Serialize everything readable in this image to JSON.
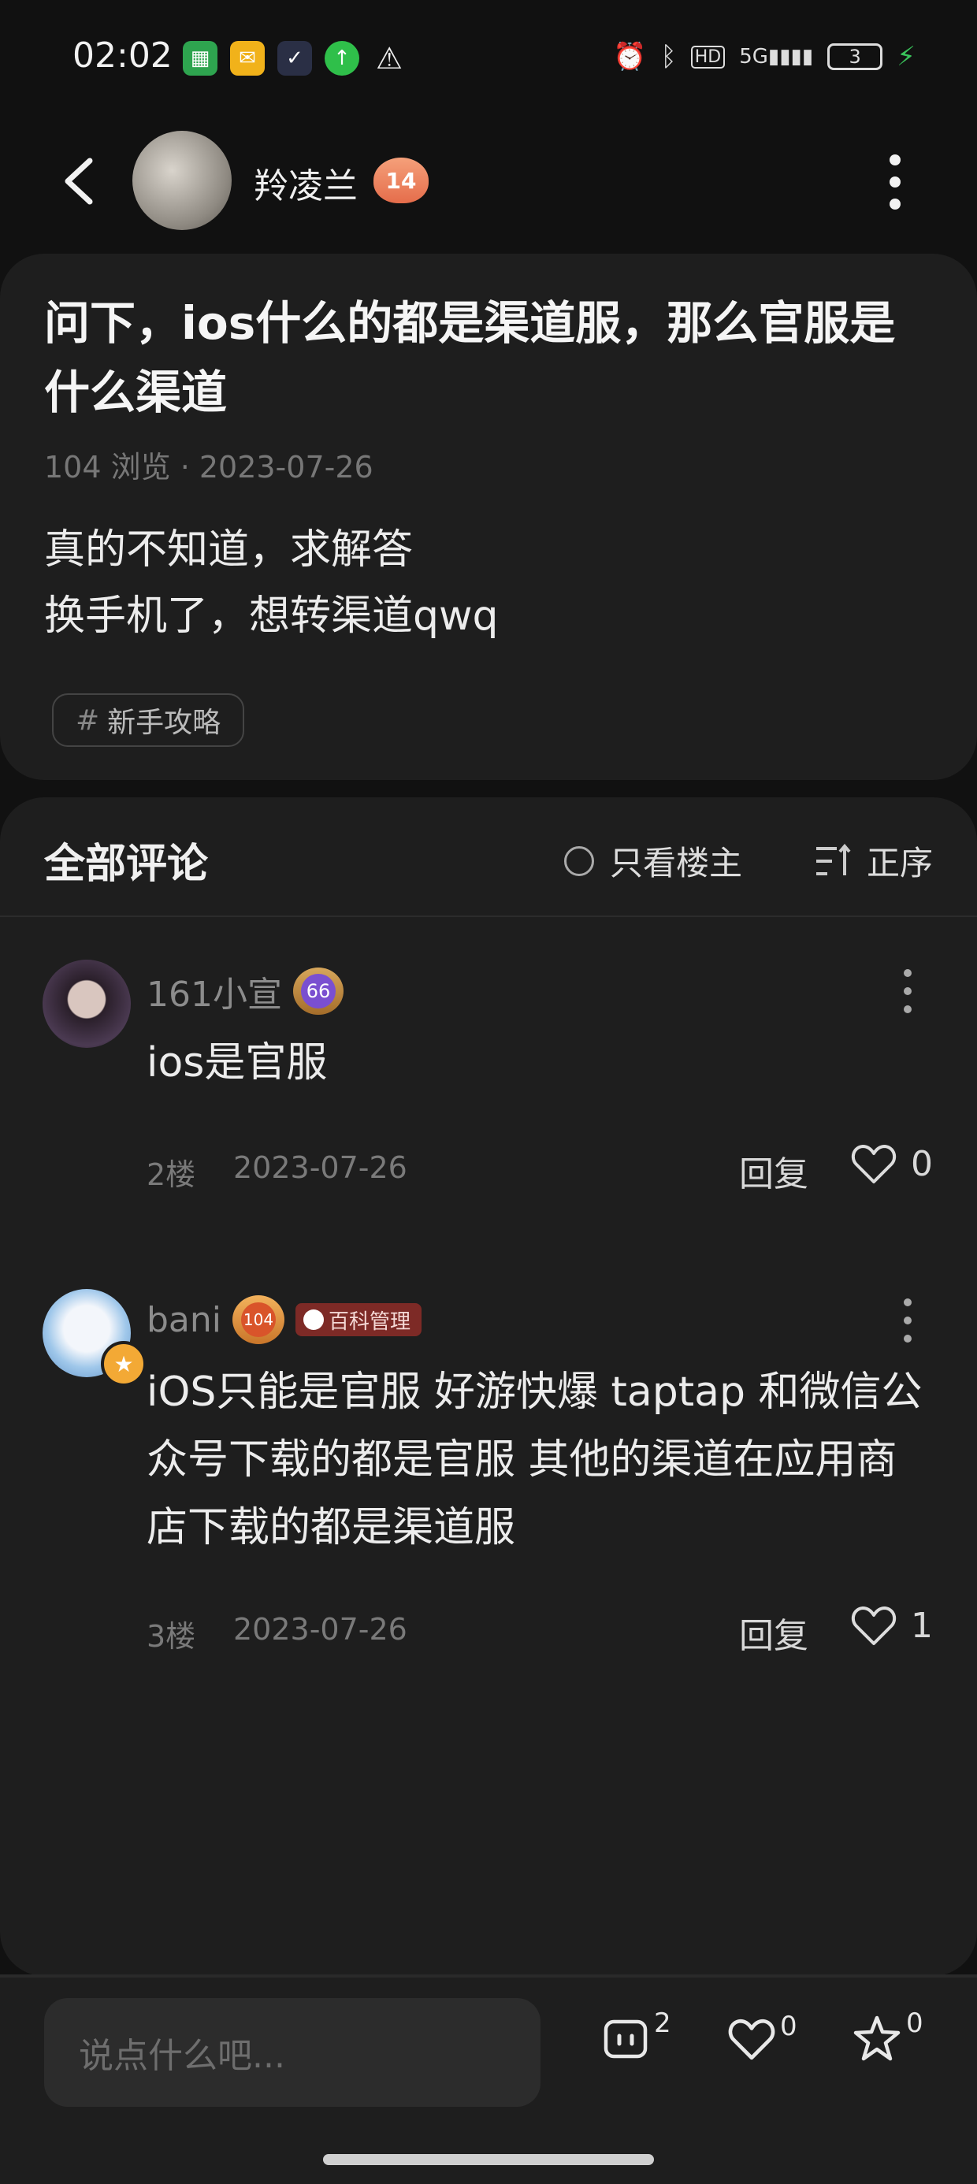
{
  "status_bar": {
    "time": "02:02",
    "notif_icons": [
      "app-icon",
      "mail-icon",
      "check-icon",
      "upload-icon",
      "warning-icon"
    ],
    "right_icons": [
      "alarm-icon",
      "bluetooth-icon",
      "hd-icon",
      "5g-signal-icon"
    ],
    "battery": "3"
  },
  "header": {
    "author_name": "羚凌兰",
    "author_level": "14"
  },
  "post": {
    "title": "问下，ios什么的都是渠道服，那么官服是什么渠道",
    "meta": "104 浏览 · 2023-07-26",
    "body_line1": "真的不知道，求解答",
    "body_line2": "换手机了，想转渠道qwq",
    "tag_symbol": "#",
    "tag": "新手攻略"
  },
  "comments_section": {
    "title": "全部评论",
    "only_op_label": "只看楼主",
    "sort_label": "正序"
  },
  "comments": [
    {
      "username": "161小宣",
      "level": "66",
      "text": "ios是官服",
      "floor": "2楼",
      "date": "2023-07-26",
      "reply_label": "回复",
      "likes": "0"
    },
    {
      "username": "bani",
      "level": "104",
      "role_badge": "百科管理",
      "text": "iOS只能是官服 好游快爆 taptap 和微信公众号下载的都是官服  其他的渠道在应用商店下载的都是渠道服",
      "floor": "3楼",
      "date": "2023-07-26",
      "reply_label": "回复",
      "likes": "1"
    }
  ],
  "bottom_bar": {
    "input_placeholder": "说点什么吧...",
    "comment_count": "2",
    "like_count": "0",
    "favorite_count": "0"
  },
  "colors": {
    "background": "#111111",
    "card": "#1e1e1e",
    "text_primary": "#ececec",
    "text_secondary": "#7a7a7a",
    "level_badge": "#e56d4b",
    "manager_badge": "#7d2a26"
  }
}
